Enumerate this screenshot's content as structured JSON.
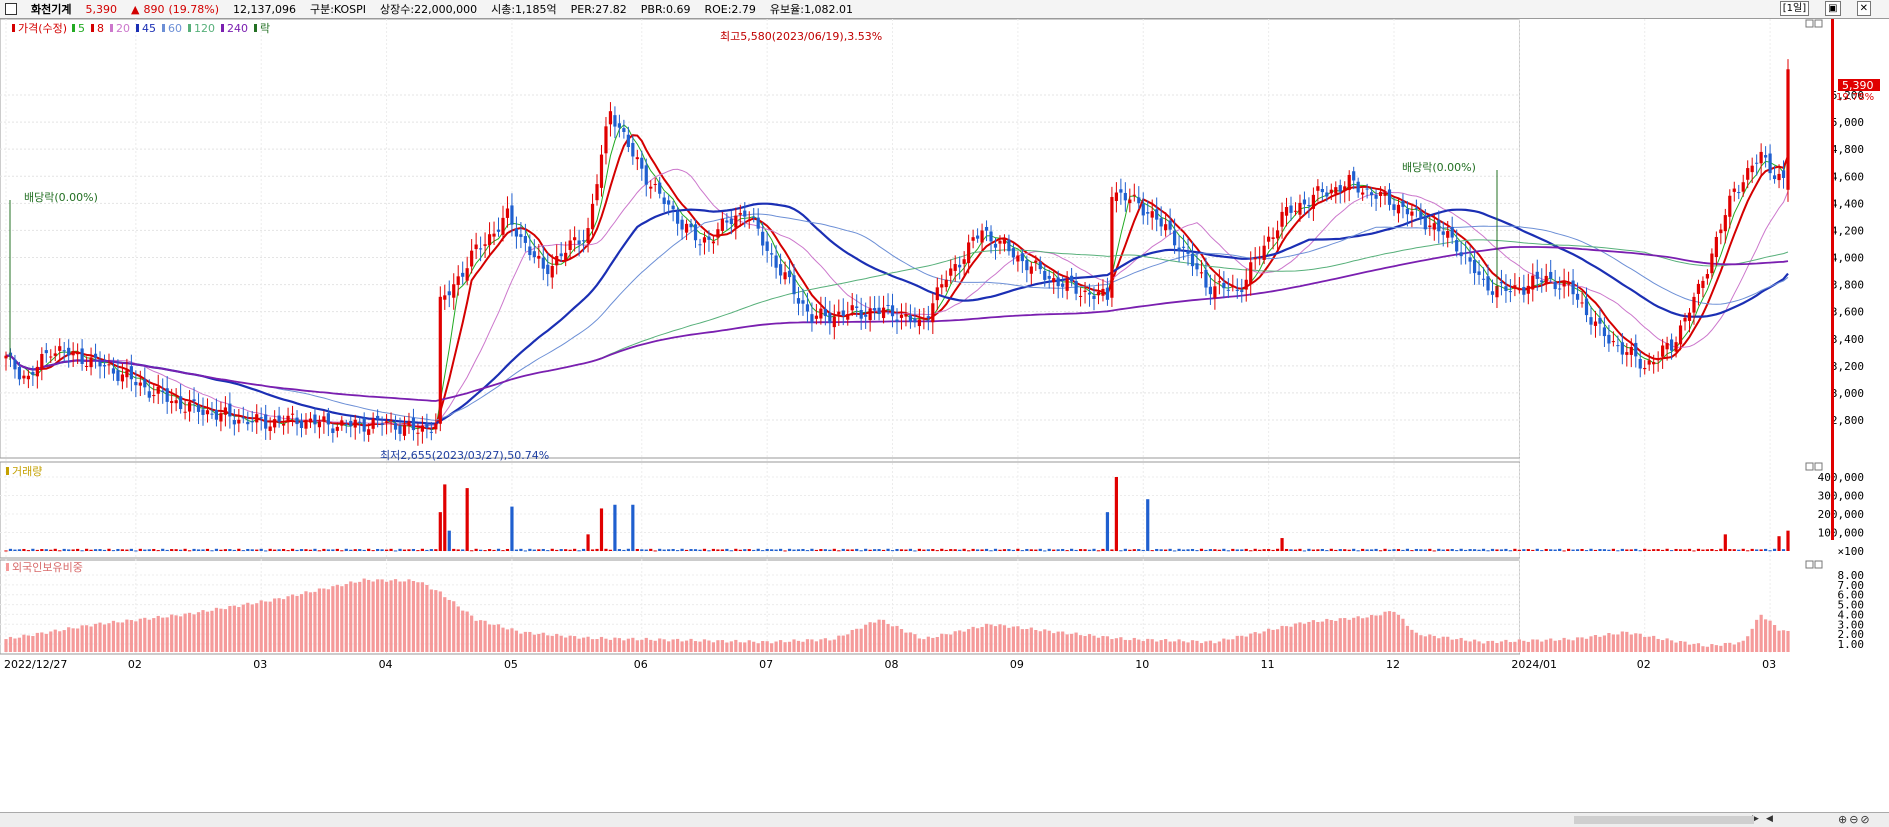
{
  "header": {
    "stock_name": "화천기계",
    "price": "5,390",
    "change_arrow": "▲",
    "change": "890",
    "change_pct": "(19.78%)",
    "volume": "12,137,096",
    "market": "구분:KOSPI",
    "shares": "상장수:22,000,000",
    "mcap": "시총:1,185억",
    "per": "PER:27.82",
    "pbr": "PBR:0.69",
    "roe": "ROE:2.79",
    "reserve": "유보율:1,082.01",
    "period_button": "[1일]",
    "restore_icon": "restore-icon",
    "close_icon": "close-icon"
  },
  "legend": {
    "items": [
      {
        "label": "가격(수정)",
        "color": "#d40000"
      },
      {
        "label": "5",
        "color": "#22aa22"
      },
      {
        "label": "8",
        "color": "#d40000"
      },
      {
        "label": "20",
        "color": "#cc77cc"
      },
      {
        "label": "45",
        "color": "#1b2fb4"
      },
      {
        "label": "60",
        "color": "#6c8fd6"
      },
      {
        "label": "120",
        "color": "#57b07a"
      },
      {
        "label": "240",
        "color": "#7a1fb0"
      },
      {
        "label": "락",
        "color": "#237023"
      }
    ]
  },
  "volume_panel_title": "거래량",
  "foreign_panel_title": "외국인보유비중",
  "annotations": {
    "high": "최고5,580(2023/06/19),3.53%",
    "low": "최저2,655(2023/03/27),50.74%",
    "div1": "배당락(0.00%)",
    "div2": "배당락(0.00%)",
    "last_price": "5,390",
    "last_pct": "19.78%"
  },
  "chart_data": {
    "type": "candlestick",
    "price_axis_ticks": [
      2800,
      3000,
      3200,
      3400,
      3600,
      3800,
      4000,
      4200,
      4400,
      4600,
      4800,
      5000,
      5200
    ],
    "price_axis_labels": [
      "2,800",
      "3,000",
      "3,200",
      "3,400",
      "3,600",
      "3,800",
      "4,000",
      "4,200",
      "4,400",
      "4,600",
      "4,800",
      "5,000",
      "5,200"
    ],
    "volume_axis_ticks": [
      100,
      100000,
      200000,
      300000,
      400000
    ],
    "volume_axis_labels": [
      "×100",
      "100,000",
      "200,000",
      "300,000",
      "400,000"
    ],
    "foreign_axis_ticks": [
      1,
      2,
      3,
      4,
      5,
      6,
      7,
      8
    ],
    "foreign_axis_labels": [
      "1.00",
      "2.00",
      "3.00",
      "4.00",
      "5.00",
      "6.00",
      "7.00",
      "8.00"
    ],
    "x_labels": [
      "2022/12/27",
      "02",
      "03",
      "04",
      "05",
      "06",
      "07",
      "08",
      "09",
      "10",
      "11",
      "12",
      "2024/01",
      "02",
      "03"
    ],
    "price_keypoints": [
      [
        0,
        3250
      ],
      [
        5,
        3100
      ],
      [
        10,
        3330
      ],
      [
        18,
        3250
      ],
      [
        25,
        3150
      ],
      [
        32,
        3020
      ],
      [
        40,
        2900
      ],
      [
        50,
        2820
      ],
      [
        57,
        2780
      ],
      [
        65,
        2800
      ],
      [
        75,
        2760
      ],
      [
        85,
        2780
      ],
      [
        92,
        2720
      ],
      [
        96,
        2780
      ],
      [
        97,
        3650
      ],
      [
        105,
        4050
      ],
      [
        112,
        4300
      ],
      [
        120,
        3900
      ],
      [
        130,
        4200
      ],
      [
        135,
        5100
      ],
      [
        140,
        4750
      ],
      [
        146,
        4450
      ],
      [
        155,
        4100
      ],
      [
        165,
        4350
      ],
      [
        172,
        3950
      ],
      [
        180,
        3550
      ],
      [
        190,
        3600
      ],
      [
        198,
        3600
      ],
      [
        204,
        3500
      ],
      [
        210,
        3850
      ],
      [
        218,
        4200
      ],
      [
        226,
        4000
      ],
      [
        233,
        3850
      ],
      [
        240,
        3750
      ],
      [
        246,
        3700
      ],
      [
        247,
        4500
      ],
      [
        255,
        4350
      ],
      [
        262,
        4100
      ],
      [
        268,
        3800
      ],
      [
        275,
        3750
      ],
      [
        285,
        4300
      ],
      [
        292,
        4450
      ],
      [
        300,
        4550
      ],
      [
        310,
        4400
      ],
      [
        318,
        4250
      ],
      [
        324,
        4100
      ],
      [
        330,
        3800
      ],
      [
        336,
        3750
      ],
      [
        344,
        3850
      ],
      [
        350,
        3750
      ],
      [
        356,
        3450
      ],
      [
        362,
        3300
      ],
      [
        366,
        3200
      ],
      [
        372,
        3350
      ],
      [
        378,
        3750
      ],
      [
        386,
        4500
      ],
      [
        392,
        4750
      ],
      [
        397,
        4550
      ],
      [
        398,
        5390
      ]
    ],
    "ma_periods": [
      5,
      8,
      20,
      45,
      60,
      120,
      240
    ],
    "ma_colors": [
      "#22aa22",
      "#d40000",
      "#cc77cc",
      "#1b2fb4",
      "#6c8fd6",
      "#57b07a",
      "#7a1fb0"
    ],
    "volume_spikes": [
      [
        97,
        210000
      ],
      [
        98,
        360000
      ],
      [
        99,
        110000
      ],
      [
        103,
        340000
      ],
      [
        107,
        5000
      ],
      [
        113,
        240000
      ],
      [
        130,
        90000
      ],
      [
        133,
        230000
      ],
      [
        136,
        250000
      ],
      [
        140,
        250000
      ],
      [
        246,
        210000
      ],
      [
        248,
        400000
      ],
      [
        255,
        280000
      ],
      [
        285,
        70000
      ],
      [
        384,
        90000
      ],
      [
        396,
        80000
      ],
      [
        398,
        110000
      ]
    ],
    "foreign_keypoints": [
      [
        0,
        1.5
      ],
      [
        20,
        3.0
      ],
      [
        40,
        4.0
      ],
      [
        60,
        5.5
      ],
      [
        80,
        7.5
      ],
      [
        92,
        7.4
      ],
      [
        97,
        6.2
      ],
      [
        105,
        3.5
      ],
      [
        115,
        2.2
      ],
      [
        130,
        1.6
      ],
      [
        150,
        1.4
      ],
      [
        170,
        1.2
      ],
      [
        185,
        1.5
      ],
      [
        195,
        3.5
      ],
      [
        205,
        1.5
      ],
      [
        220,
        3.0
      ],
      [
        235,
        2.2
      ],
      [
        250,
        1.5
      ],
      [
        270,
        1.2
      ],
      [
        290,
        3.2
      ],
      [
        305,
        3.8
      ],
      [
        310,
        4.4
      ],
      [
        315,
        2.0
      ],
      [
        330,
        1.2
      ],
      [
        350,
        1.5
      ],
      [
        362,
        2.2
      ],
      [
        370,
        1.5
      ],
      [
        380,
        0.8
      ],
      [
        388,
        1.2
      ],
      [
        392,
        4.0
      ],
      [
        396,
        2.5
      ],
      [
        398,
        2.2
      ]
    ]
  }
}
